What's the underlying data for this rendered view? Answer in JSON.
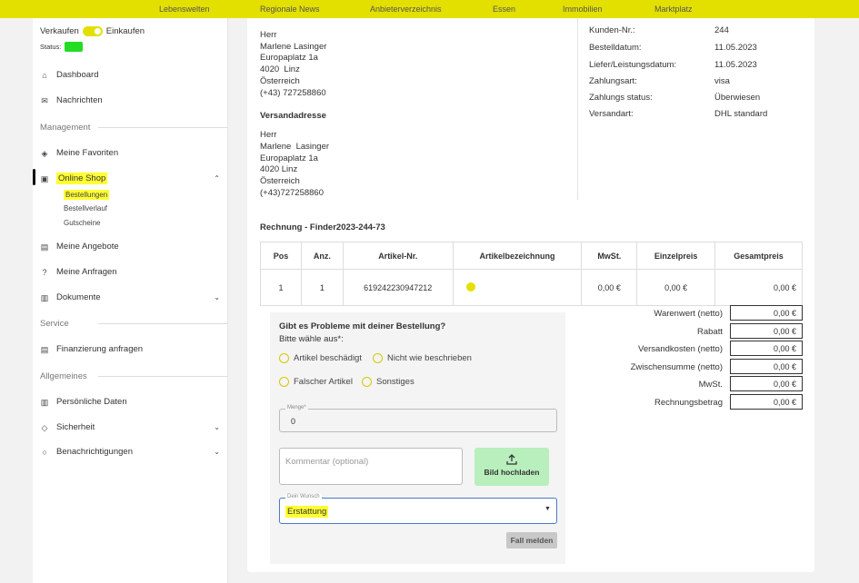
{
  "topnav": [
    "Lebenswelten",
    "Regionale News",
    "Anbieterverzeichnis",
    "Essen",
    "Immobilien",
    "Marktplatz"
  ],
  "sidebar": {
    "toggle_left": "Verkaufen",
    "toggle_right": "Einkaufen",
    "status_label": "Status:",
    "dashboard": "Dashboard",
    "nachrichten": "Nachrichten",
    "section_management": "Management",
    "favoriten": "Meine Favoriten",
    "online_shop": "Online Shop",
    "bestellungen": "Bestellungen",
    "bestellverlauf": "Bestellverlauf",
    "gutscheine": "Gutscheine",
    "angebote": "Meine Angebote",
    "anfragen": "Meine Anfragen",
    "dokumente": "Dokumente",
    "section_service": "Service",
    "finanzierung": "Finanzierung anfragen",
    "section_allgemeines": "Allgemeines",
    "persoenliche_daten": "Persönliche Daten",
    "sicherheit": "Sicherheit",
    "benachrichtigungen": "Benachrichtigungen"
  },
  "billing": {
    "salutation": "Herr",
    "name": "Marlene Lasinger",
    "street": "Europaplatz 1a",
    "city": "4020  Linz",
    "country": "Österreich",
    "phone": "(+43) 727258860"
  },
  "shipping": {
    "heading": "Versandadresse",
    "salutation": "Herr",
    "name": "Marlene  Lasinger",
    "street": "Europaplatz 1a",
    "city": "4020 Linz",
    "country": "Österreich",
    "phone": "(+43)727258860"
  },
  "meta": [
    {
      "label": "Kunden-Nr.:",
      "value": "244"
    },
    {
      "label": "Bestelldatum:",
      "value": "11.05.2023"
    },
    {
      "label": "Liefer/Leistungsdatum:",
      "value": "11.05.2023"
    },
    {
      "label": "Zahlungsart:",
      "value": "visa"
    },
    {
      "label": "Zahlungs status:",
      "value": "Überwiesen"
    },
    {
      "label": "Versandart:",
      "value": "DHL standard"
    }
  ],
  "invoice_title": "Rechnung - Finder2023-244-73",
  "table": {
    "headers": [
      "Pos",
      "Anz.",
      "Artikel-Nr.",
      "Artikelbezeichnung",
      "MwSt.",
      "Einzelpreis",
      "Gesamtpreis"
    ],
    "row": [
      "1",
      "1",
      "619242230947212",
      "",
      "0,00 €",
      "0,00 €",
      "0,00 €"
    ]
  },
  "totals": [
    {
      "label": "Warenwert (netto)",
      "value": "0,00 €"
    },
    {
      "label": "Rabatt",
      "value": "0,00 €"
    },
    {
      "label": "Versandkosten (netto)",
      "value": "0,00 €"
    },
    {
      "label": "Zwischensumme (netto)",
      "value": "0,00 €"
    },
    {
      "label": "MwSt.",
      "value": "0,00 €"
    },
    {
      "label": "Rechnungsbetrag",
      "value": "0,00 €"
    }
  ],
  "problem": {
    "heading": "Gibt es Probleme mit deiner Bestellung?",
    "subheading": "Bitte wähle aus*:",
    "options": [
      "Artikel beschädigt",
      "Nicht wie beschrieben",
      "Falscher Artikel",
      "Sonstiges"
    ],
    "menge_label": "Menge*",
    "menge_value": "0",
    "comment_placeholder": "Kommentar (optional)",
    "upload_label": "Bild hochladen",
    "wish_label": "Dein Wunsch",
    "wish_value": "Erstattung",
    "report_button": "Fall melden"
  },
  "colors": {
    "accent": "#e3e000",
    "highlight": "#ffff33",
    "upload": "#b8efbc",
    "status": "#22dd22"
  }
}
